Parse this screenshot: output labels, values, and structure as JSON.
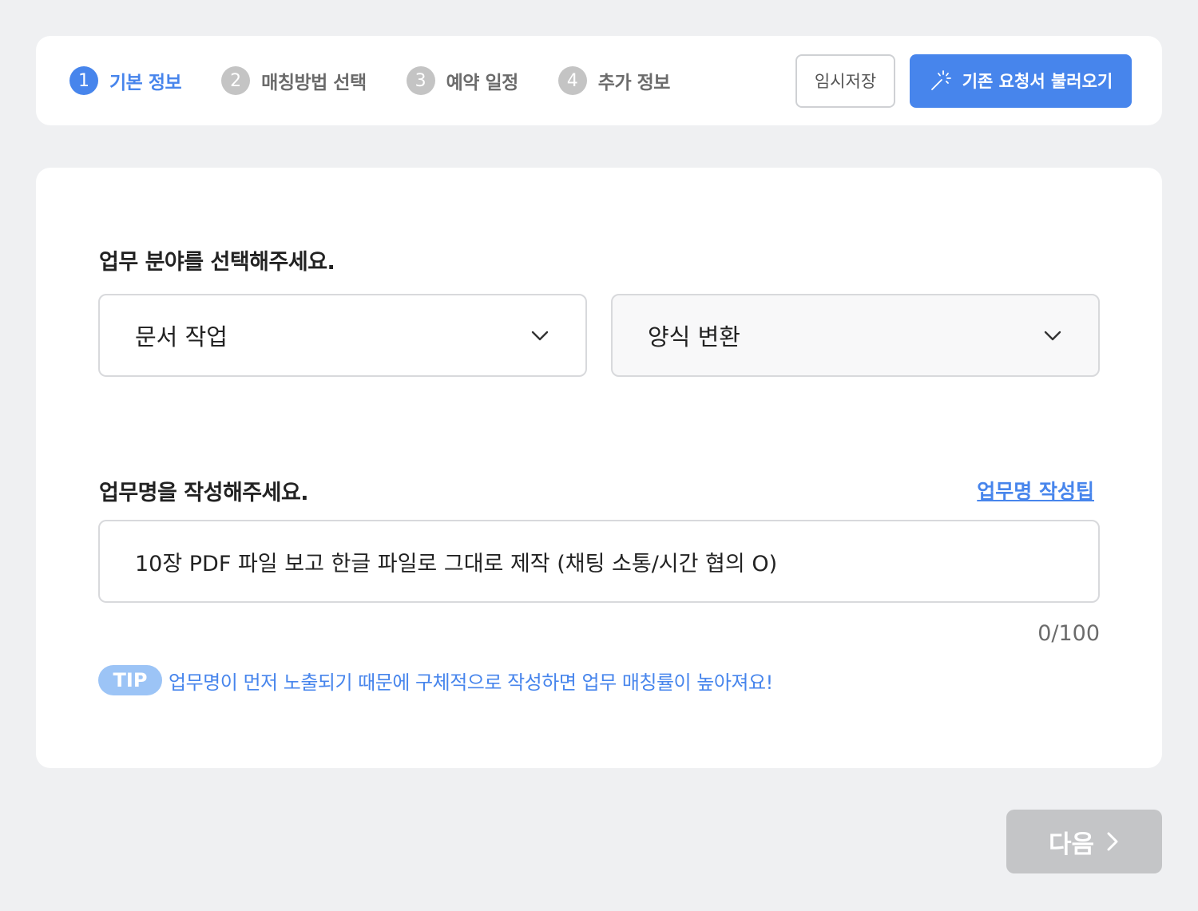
{
  "steps": [
    {
      "num": "1",
      "label": "기본 정보",
      "active": true
    },
    {
      "num": "2",
      "label": "매칭방법 선택",
      "active": false
    },
    {
      "num": "3",
      "label": "예약 일정",
      "active": false
    },
    {
      "num": "4",
      "label": "추가 정보",
      "active": false
    }
  ],
  "toolbar": {
    "temp_save_label": "임시저장",
    "load_request_label": "기존 요청서 불러오기",
    "load_icon": "magic-wand-icon"
  },
  "category": {
    "title": "업무 분야를 선택해주세요.",
    "primary_value": "문서 작업",
    "secondary_value": "양식 변환"
  },
  "job_name": {
    "title": "업무명을 작성해주세요.",
    "tip_link": "업무명 작성팁",
    "value": "10장 PDF 파일 보고 한글 파일로 그대로 제작 (채팅 소통/시간 협의 O)",
    "counter": "0/100",
    "tip_badge": "TIP",
    "tip_text": "업무명이 먼저 노출되기 때문에 구체적으로 작성하면 업무 매칭률이 높아져요!"
  },
  "footer": {
    "next_label": "다음"
  },
  "colors": {
    "accent": "#4785ec",
    "inactive_step": "#c4c4c4",
    "disabled_button": "#c4c5c7",
    "background": "#eff0f2"
  }
}
